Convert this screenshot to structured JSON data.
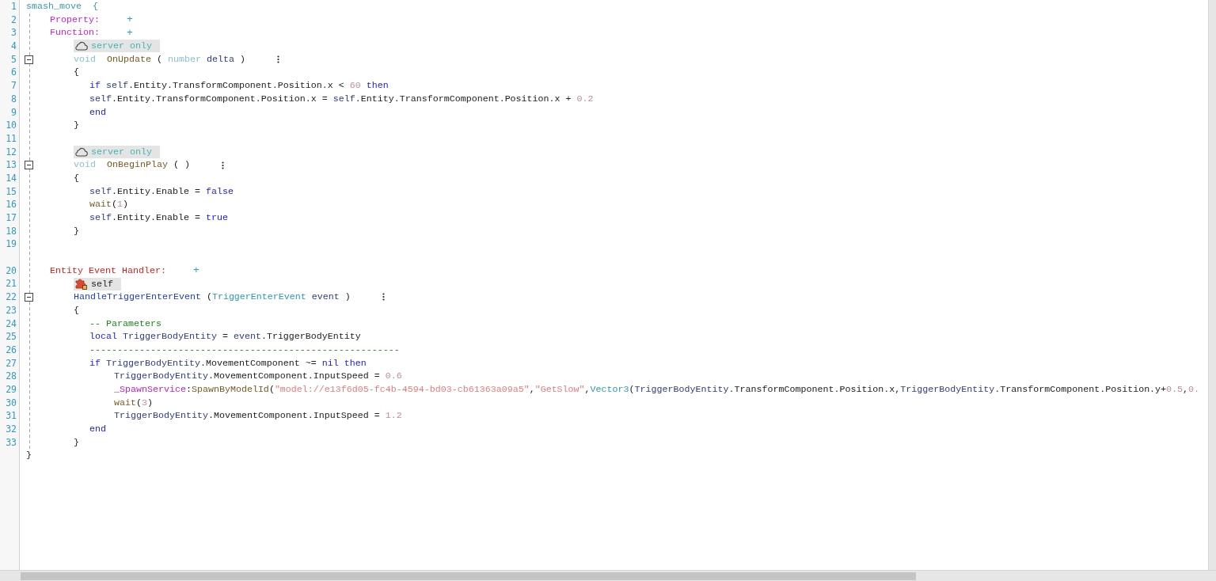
{
  "editor": {
    "lines": [
      {
        "number": "1",
        "kind": "header",
        "tokens": [
          {
            "kind": "name",
            "text": "smash_move  {"
          }
        ]
      },
      {
        "number": "2",
        "kind": "section",
        "tokens": [
          {
            "kind": "property",
            "text": "Property:"
          }
        ],
        "add": "+"
      },
      {
        "number": "3",
        "kind": "section",
        "tokens": [
          {
            "kind": "property",
            "text": "Function:"
          }
        ],
        "add": "+"
      },
      {
        "number": "4",
        "kind": "server-badge",
        "badge": "server only"
      },
      {
        "number": "5",
        "kind": "signature",
        "fold": {
          "expanded": true
        },
        "menu": true,
        "tokens": [
          {
            "kind": "type",
            "text": "void "
          },
          {
            "kind": "func",
            "text": " OnUpdate "
          },
          {
            "kind": "plain",
            "text": "( "
          },
          {
            "kind": "type",
            "text": "number "
          },
          {
            "kind": "var",
            "text": "delta"
          },
          {
            "kind": "plain",
            "text": " )"
          }
        ]
      },
      {
        "number": "6",
        "kind": "brace",
        "tokens": [
          {
            "kind": "plain",
            "text": "{"
          }
        ]
      },
      {
        "number": "7",
        "kind": "statement",
        "tokens": [
          {
            "kind": "keyword",
            "text": "if "
          },
          {
            "kind": "var",
            "text": "self"
          },
          {
            "kind": "plain",
            "text": ".Entity.TransformComponent.Position.x < "
          },
          {
            "kind": "number",
            "text": "60"
          },
          {
            "kind": "keyword",
            "text": " then"
          }
        ]
      },
      {
        "number": "8",
        "kind": "statement",
        "tokens": [
          {
            "kind": "var",
            "text": "self"
          },
          {
            "kind": "plain",
            "text": ".Entity.TransformComponent.Position.x = "
          },
          {
            "kind": "var",
            "text": "self"
          },
          {
            "kind": "plain",
            "text": ".Entity.TransformComponent.Position.x + "
          },
          {
            "kind": "number",
            "text": "0.2"
          }
        ]
      },
      {
        "number": "9",
        "kind": "statement",
        "tokens": [
          {
            "kind": "keyword",
            "text": "end"
          }
        ]
      },
      {
        "number": "10",
        "kind": "brace",
        "tokens": [
          {
            "kind": "plain",
            "text": "}"
          }
        ]
      },
      {
        "number": "11",
        "kind": "blank"
      },
      {
        "number": "12",
        "kind": "server-badge",
        "badge": "server only"
      },
      {
        "number": "13",
        "kind": "signature",
        "fold": {
          "expanded": true
        },
        "menu": true,
        "tokens": [
          {
            "kind": "type",
            "text": "void "
          },
          {
            "kind": "func",
            "text": " OnBeginPlay "
          },
          {
            "kind": "plain",
            "text": "( )"
          }
        ]
      },
      {
        "number": "14",
        "kind": "brace",
        "tokens": [
          {
            "kind": "plain",
            "text": "{"
          }
        ]
      },
      {
        "number": "15",
        "kind": "statement",
        "tokens": [
          {
            "kind": "var",
            "text": "self"
          },
          {
            "kind": "plain",
            "text": ".Entity.Enable = "
          },
          {
            "kind": "keyword",
            "text": "false"
          }
        ]
      },
      {
        "number": "16",
        "kind": "statement",
        "tokens": [
          {
            "kind": "func",
            "text": "wait"
          },
          {
            "kind": "plain",
            "text": "("
          },
          {
            "kind": "number",
            "text": "1"
          },
          {
            "kind": "plain",
            "text": ")"
          }
        ]
      },
      {
        "number": "17",
        "kind": "statement",
        "tokens": [
          {
            "kind": "var",
            "text": "self"
          },
          {
            "kind": "plain",
            "text": ".Entity.Enable = "
          },
          {
            "kind": "keyword",
            "text": "true"
          }
        ]
      },
      {
        "number": "18",
        "kind": "brace",
        "tokens": [
          {
            "kind": "plain",
            "text": "}"
          }
        ]
      },
      {
        "number": "19",
        "kind": "blank"
      },
      {
        "kind": "spacer"
      },
      {
        "number": "20",
        "kind": "section",
        "tokens": [
          {
            "kind": "event",
            "text": "Entity Event Handler:"
          }
        ],
        "add": "+"
      },
      {
        "number": "21",
        "kind": "entity-badge",
        "badge": "self"
      },
      {
        "number": "22",
        "kind": "signature",
        "fold": {
          "expanded": true
        },
        "menu": true,
        "tokens": [
          {
            "kind": "handler",
            "text": "HandleTriggerEnterEvent "
          },
          {
            "kind": "plain",
            "text": "("
          },
          {
            "kind": "class",
            "text": "TriggerEnterEvent "
          },
          {
            "kind": "var",
            "text": "event"
          },
          {
            "kind": "plain",
            "text": " )"
          }
        ]
      },
      {
        "number": "23",
        "kind": "brace",
        "tokens": [
          {
            "kind": "plain",
            "text": "{"
          }
        ]
      },
      {
        "number": "24",
        "kind": "statement",
        "tokens": [
          {
            "kind": "comment",
            "text": "-- Parameters"
          }
        ]
      },
      {
        "number": "25",
        "kind": "statement",
        "tokens": [
          {
            "kind": "keyword",
            "text": "local "
          },
          {
            "kind": "var",
            "text": "TriggerBodyEntity"
          },
          {
            "kind": "plain",
            "text": " = "
          },
          {
            "kind": "var",
            "text": "event"
          },
          {
            "kind": "plain",
            "text": ".TriggerBodyEntity"
          }
        ]
      },
      {
        "number": "26",
        "kind": "statement",
        "tokens": [
          {
            "kind": "comment",
            "text": "--------------------------------------------------------"
          }
        ]
      },
      {
        "number": "27",
        "kind": "statement",
        "tokens": [
          {
            "kind": "keyword",
            "text": "if "
          },
          {
            "kind": "var",
            "text": "TriggerBodyEntity"
          },
          {
            "kind": "plain",
            "text": ".MovementComponent ~= "
          },
          {
            "kind": "keyword",
            "text": "nil then"
          }
        ]
      },
      {
        "number": "28",
        "kind": "nested",
        "tokens": [
          {
            "kind": "var",
            "text": "TriggerBodyEntity"
          },
          {
            "kind": "plain",
            "text": ".MovementComponent.InputSpeed = "
          },
          {
            "kind": "number",
            "text": "0.6"
          }
        ]
      },
      {
        "number": "29",
        "kind": "nested",
        "tokens": [
          {
            "kind": "service",
            "text": "_SpawnService"
          },
          {
            "kind": "plain",
            "text": ":"
          },
          {
            "kind": "func",
            "text": "SpawnByModelId"
          },
          {
            "kind": "plain",
            "text": "("
          },
          {
            "kind": "string",
            "text": "\"model://e13f6d05-fc4b-4594-bd03-cb61363a09a5\""
          },
          {
            "kind": "plain",
            "text": ","
          },
          {
            "kind": "string",
            "text": "\"GetSlow\""
          },
          {
            "kind": "plain",
            "text": ","
          },
          {
            "kind": "class",
            "text": "Vector3"
          },
          {
            "kind": "plain",
            "text": "("
          },
          {
            "kind": "var",
            "text": "TriggerBodyEntity"
          },
          {
            "kind": "plain",
            "text": ".TransformComponent.Position.x,"
          },
          {
            "kind": "var",
            "text": "TriggerBodyEntity"
          },
          {
            "kind": "plain",
            "text": ".TransformComponent.Position.y+"
          },
          {
            "kind": "number",
            "text": "0.5"
          },
          {
            "kind": "plain",
            "text": ","
          },
          {
            "kind": "number",
            "text": "0."
          }
        ]
      },
      {
        "number": "30",
        "kind": "nested",
        "tokens": [
          {
            "kind": "func",
            "text": "wait"
          },
          {
            "kind": "plain",
            "text": "("
          },
          {
            "kind": "number",
            "text": "3"
          },
          {
            "kind": "plain",
            "text": ")"
          }
        ]
      },
      {
        "number": "31",
        "kind": "nested",
        "tokens": [
          {
            "kind": "var",
            "text": "TriggerBodyEntity"
          },
          {
            "kind": "plain",
            "text": ".MovementComponent.InputSpeed = "
          },
          {
            "kind": "number",
            "text": "1.2"
          }
        ]
      },
      {
        "number": "32",
        "kind": "statement",
        "tokens": [
          {
            "kind": "keyword",
            "text": "end"
          }
        ]
      },
      {
        "number": "33",
        "kind": "brace",
        "tokens": [
          {
            "kind": "plain",
            "text": "}"
          }
        ]
      },
      {
        "kind": "header",
        "tokens": [
          {
            "kind": "plain",
            "text": "}"
          }
        ]
      }
    ]
  }
}
